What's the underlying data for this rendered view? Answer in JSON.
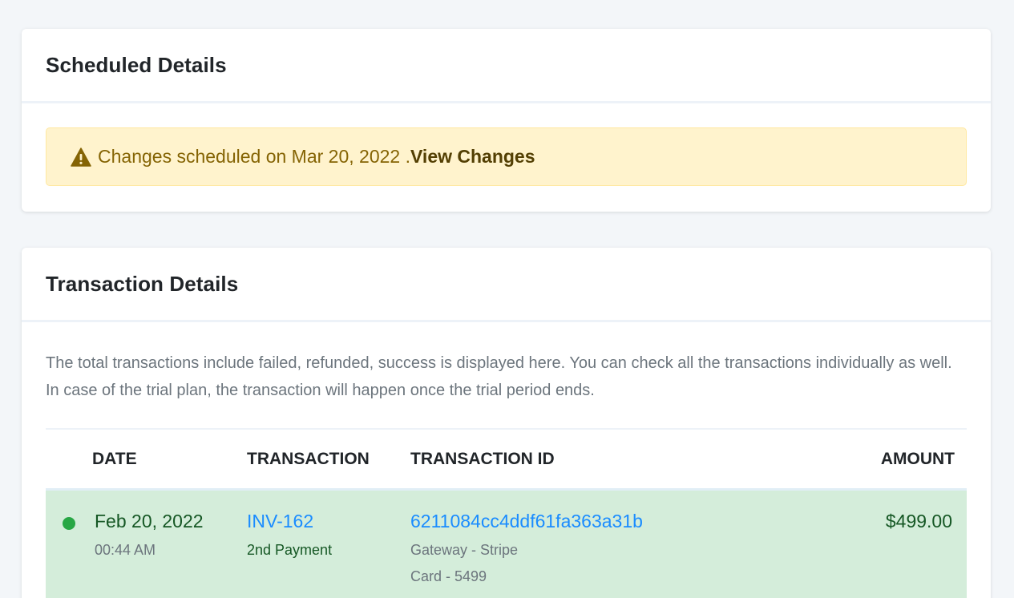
{
  "scheduled": {
    "title": "Scheduled Details",
    "alert_text": "Changes scheduled on Mar 20, 2022 .",
    "alert_link": "View Changes",
    "alert_icon": "warning-icon"
  },
  "transactions": {
    "title": "Transaction Details",
    "description": "The total transactions include failed, refunded, success is displayed here. You can check all the transactions individually as well. In case of the trial plan, the transaction will happen once the trial period ends.",
    "columns": {
      "date": "DATE",
      "transaction": "TRANSACTION",
      "transaction_id": "TRANSACTION ID",
      "amount": "AMOUNT"
    },
    "rows": [
      {
        "status": "success",
        "date": "Feb 20, 2022",
        "time": "00:44 AM",
        "invoice": "INV-162",
        "payment": "2nd Payment",
        "transaction_id": "6211084cc4ddf61fa363a31b",
        "gateway": "Gateway - Stripe",
        "card": "Card - 5499",
        "amount": "$499.00"
      }
    ]
  },
  "colors": {
    "page_bg": "#f3f6f9",
    "alert_bg": "#fff3cd",
    "alert_text": "#856404",
    "row_success_bg": "#d4edda",
    "link": "#1a8cff",
    "status_dot": "#28a745"
  }
}
